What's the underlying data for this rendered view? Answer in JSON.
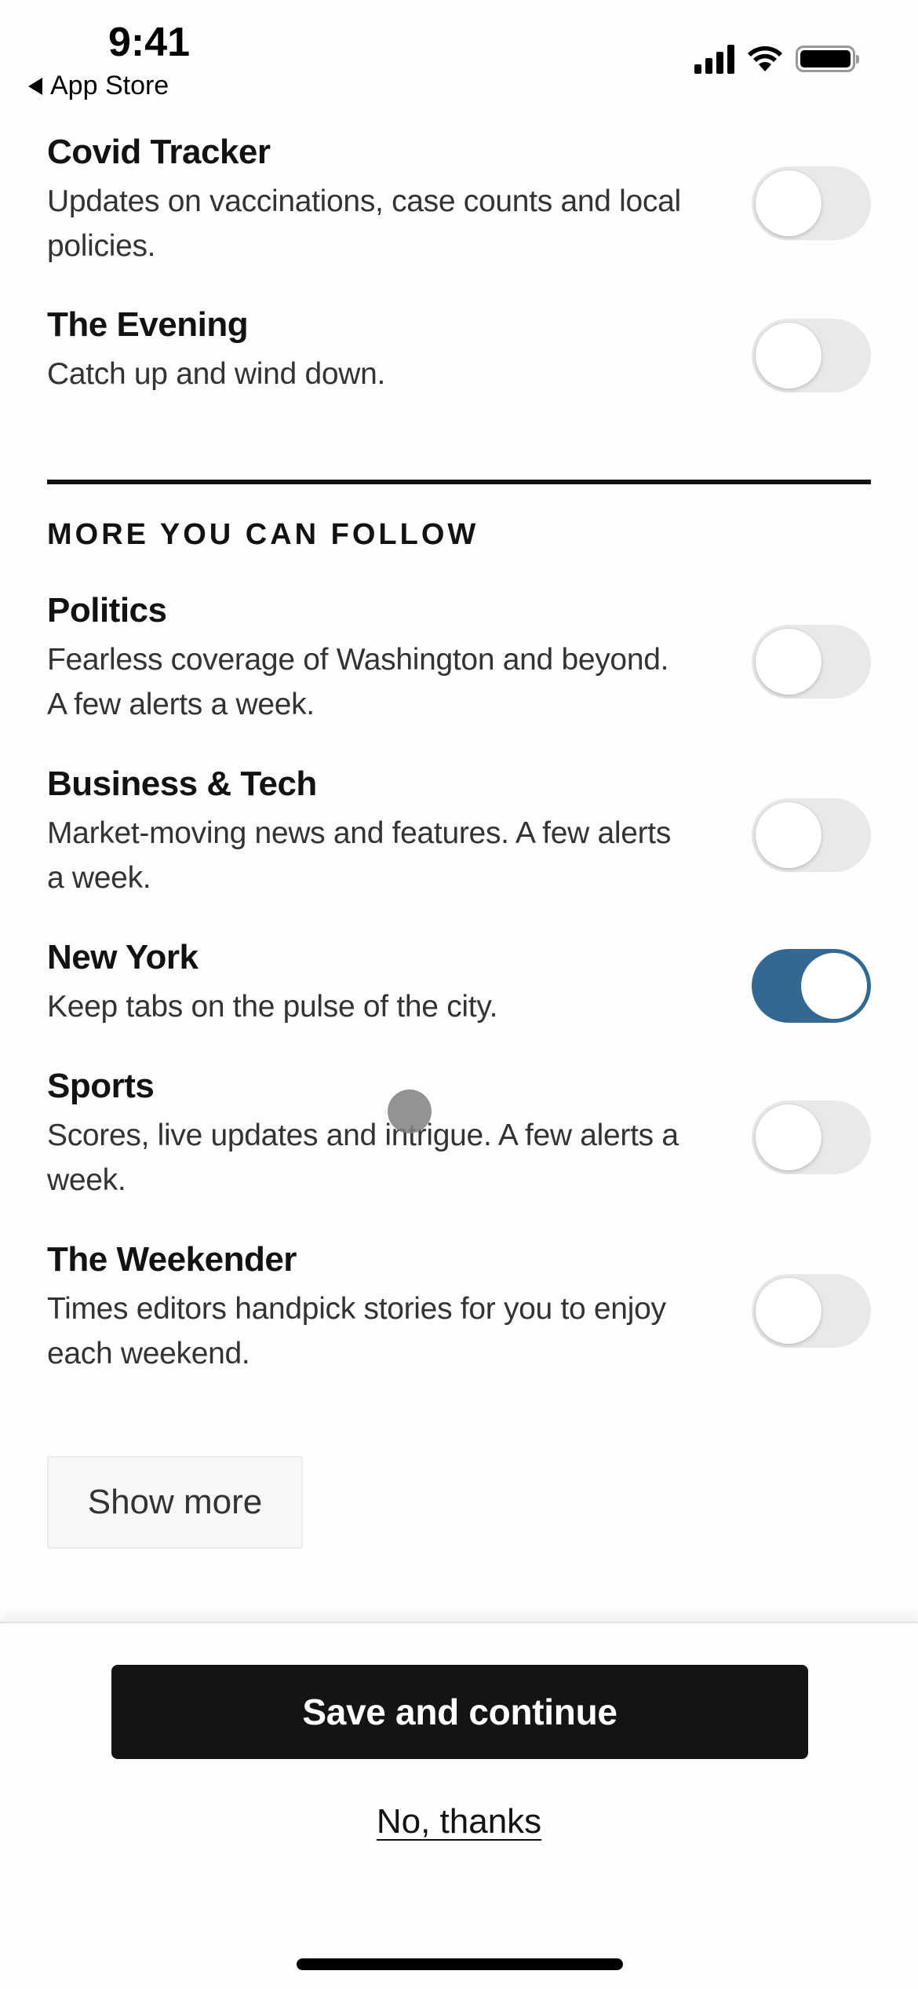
{
  "status_bar": {
    "time": "9:41",
    "back_label": "App Store",
    "icons": [
      "cellular-signal-icon",
      "wifi-icon",
      "battery-icon"
    ]
  },
  "top_items": [
    {
      "title": "Covid Tracker",
      "description": "Updates on vaccinations, case counts and local policies.",
      "enabled": false
    },
    {
      "title": "The Evening",
      "description": "Catch up and wind down.",
      "enabled": false
    }
  ],
  "section": {
    "header": "MORE YOU CAN FOLLOW",
    "items": [
      {
        "title": "Politics",
        "description": "Fearless coverage of Washington and beyond. A few alerts a week.",
        "enabled": false
      },
      {
        "title": "Business & Tech",
        "description": "Market-moving news and features. A few alerts a week.",
        "enabled": false
      },
      {
        "title": "New York",
        "description": "Keep tabs on the pulse of the city.",
        "enabled": true
      },
      {
        "title": "Sports",
        "description": "Scores, live updates and intrigue. A few alerts a week.",
        "enabled": false
      },
      {
        "title": "The Weekender",
        "description": "Times editors handpick stories for you to enjoy each weekend.",
        "enabled": false
      }
    ],
    "show_more_label": "Show more"
  },
  "footer": {
    "primary_label": "Save and continue",
    "secondary_label": "No, thanks"
  },
  "colors": {
    "toggle_on": "#326891",
    "toggle_off": "#e9e9eb",
    "primary_button": "#141316"
  }
}
